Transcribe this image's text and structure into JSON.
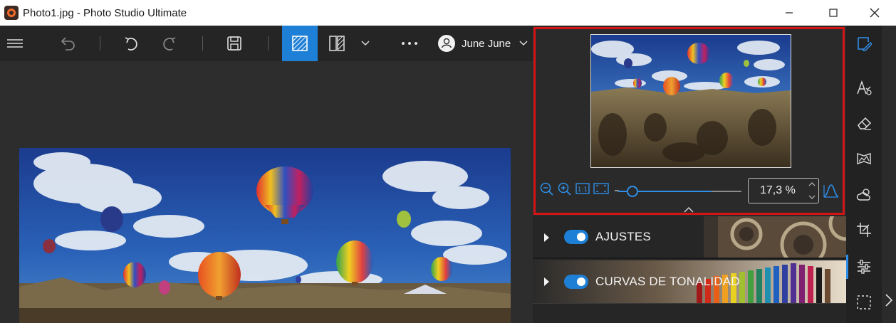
{
  "window": {
    "title": "Photo1.jpg - Photo Studio Ultimate"
  },
  "controls": {
    "minimize": "minimize-icon",
    "maximize": "maximize-icon",
    "close": "close-icon"
  },
  "toolbar": {
    "user_name": "June June",
    "more": "more-icon",
    "items": [
      "menu-icon",
      "undo-all-icon",
      "undo-icon",
      "redo-icon",
      "save-icon",
      "single-view-icon",
      "compare-view-icon",
      "chevron-down-icon"
    ]
  },
  "navigator": {
    "zoom_value": "17,3 %",
    "zoom_fraction": 0.173
  },
  "panels": [
    {
      "label": "AJUSTES",
      "enabled": true
    },
    {
      "label": "CURVAS DE TONALIDAD",
      "enabled": true
    }
  ],
  "side_icons": [
    "edit-icon",
    "text-effects-icon",
    "eraser-icon",
    "landscape-icon",
    "weather-icon",
    "crop-icon",
    "adjustments-icon",
    "selection-icon"
  ],
  "colors": {
    "accent": "#1e7fd6",
    "highlight_border": "#d31515"
  }
}
